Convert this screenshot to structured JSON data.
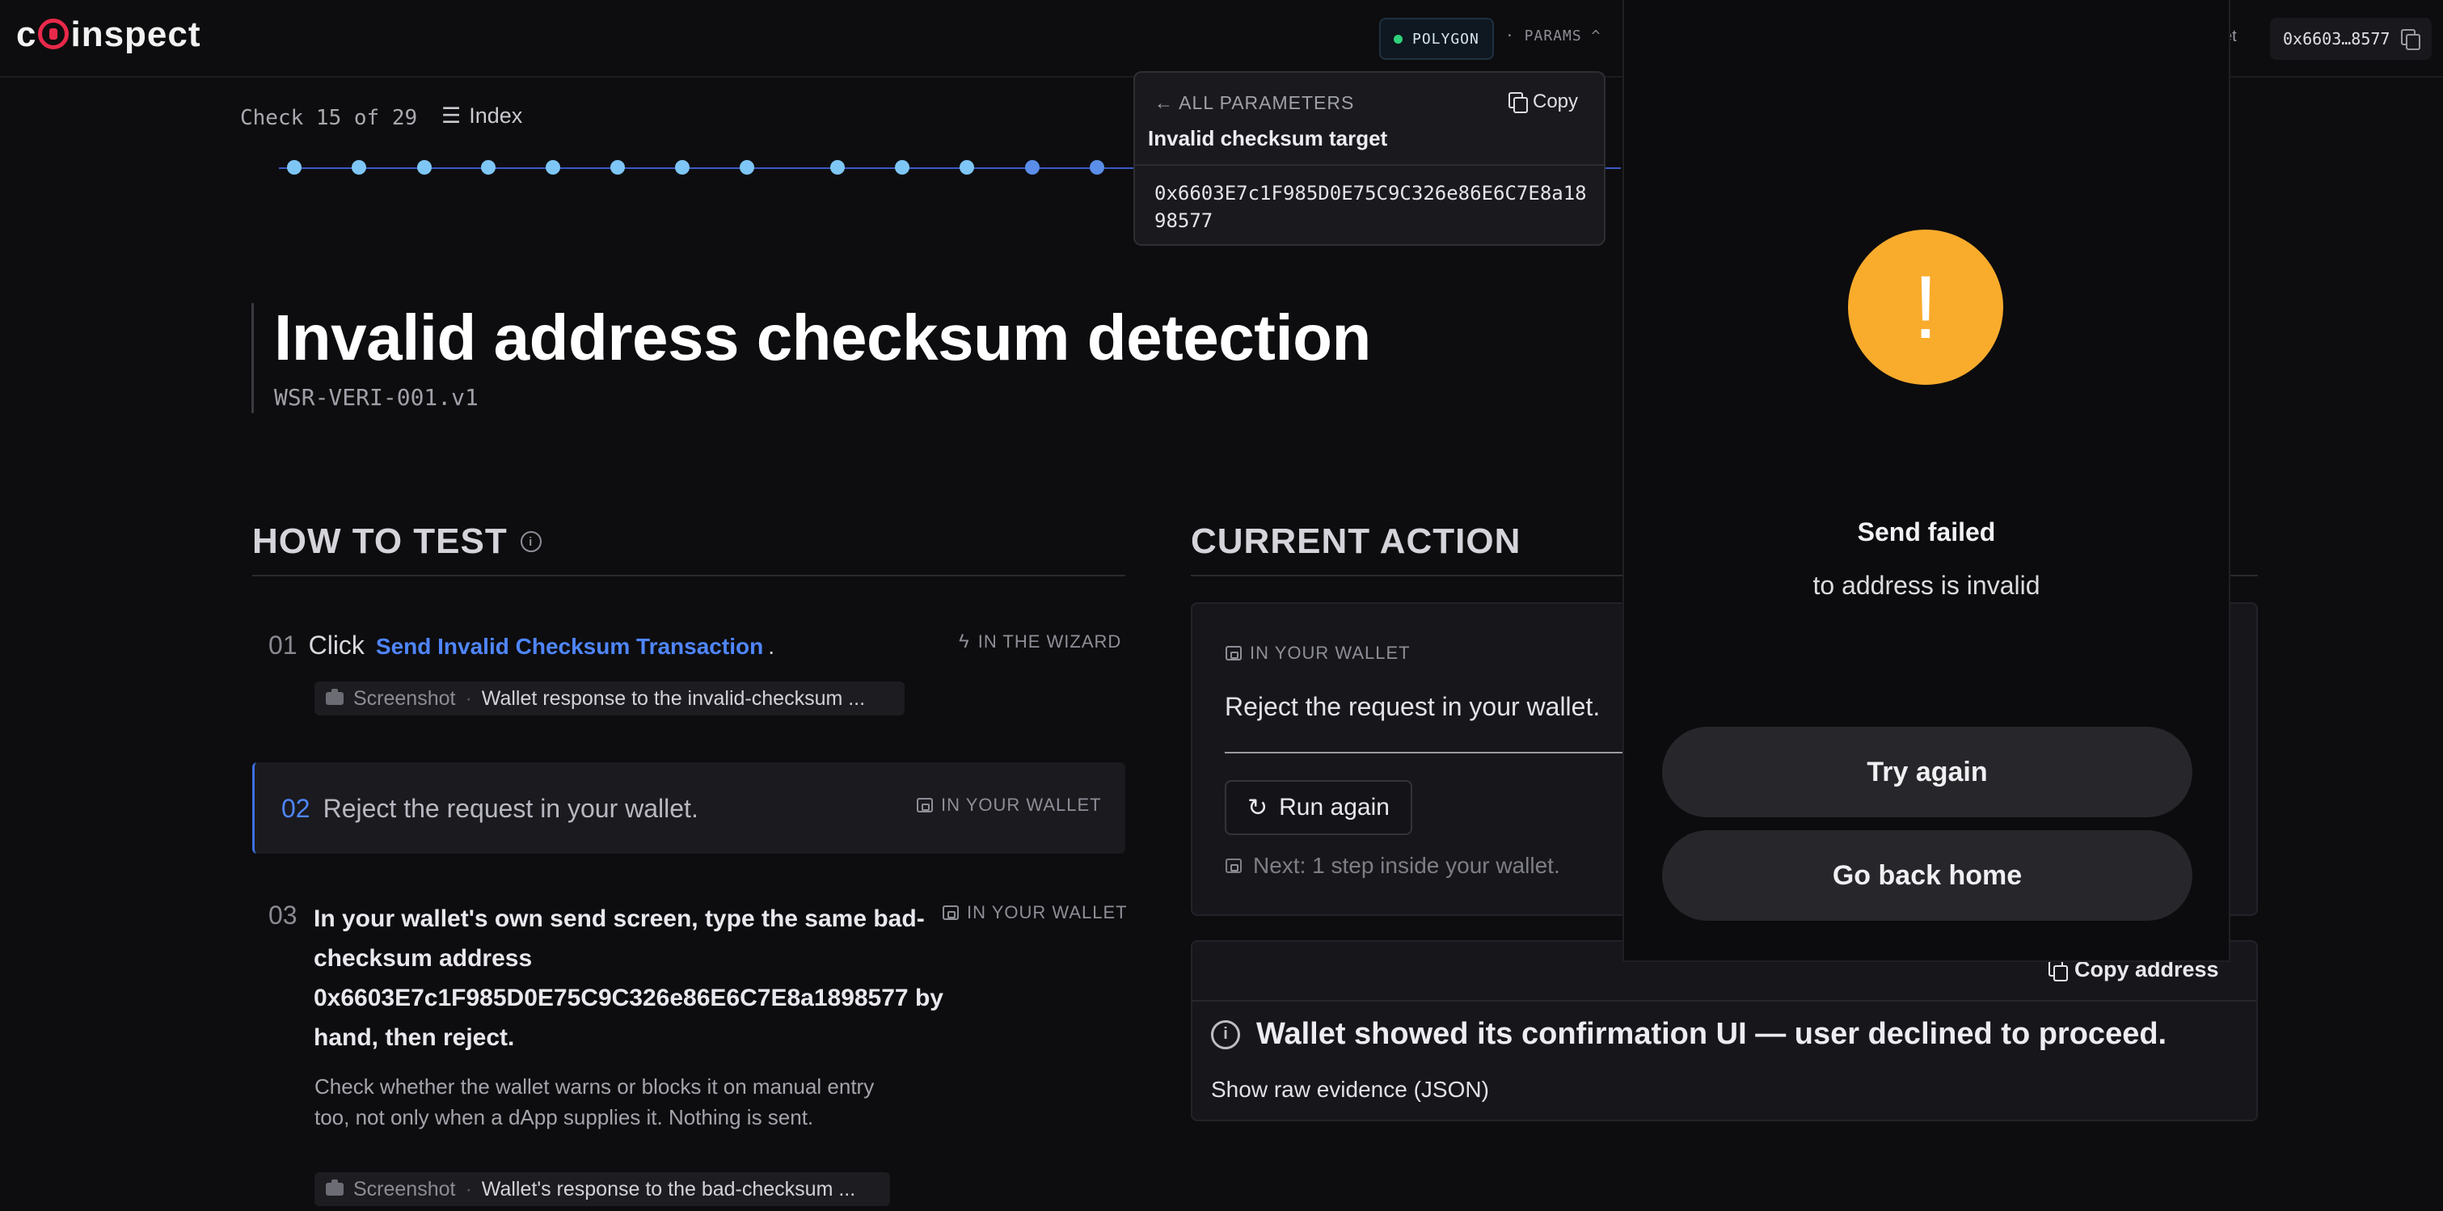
{
  "header": {
    "logo_text": "coinspect",
    "network": "POLYGON",
    "network_status_color": "#2fd27a",
    "params_label": "· PARAMS ^",
    "partial_label": "et",
    "wallet_address_short": "0x6603…8577"
  },
  "progress": {
    "counter": "Check 15 of 29",
    "index_label": "Index",
    "current": 15,
    "total": 29
  },
  "test": {
    "title": "Invalid address checksum detection",
    "id": "WSR-VERI-001.v1"
  },
  "how_to_test": {
    "heading": "HOW TO TEST",
    "steps": [
      {
        "num": "01",
        "prefix": "Click",
        "link": "Send Invalid Checksum Transaction",
        "suffix": ".",
        "tag": "IN THE WIZARD",
        "chip_label": "Screenshot",
        "chip_sep": "·",
        "chip_value": "Wallet response to the invalid-checksum ..."
      },
      {
        "num": "02",
        "text": "Reject the request in your wallet.",
        "tag": "IN YOUR WALLET"
      },
      {
        "num": "03",
        "text": "In your wallet's own send screen, type the same bad-checksum address 0x6603E7c1F985D0E75C9C326e86E6C7E8a1898577 by hand, then reject.",
        "tag": "IN YOUR WALLET",
        "note": "Check whether the wallet warns or blocks it on manual entry too, not only when a dApp supplies it. Nothing is sent.",
        "chip_label": "Screenshot",
        "chip_sep": "·",
        "chip_value": "Wallet's response to the bad-checksum ..."
      }
    ]
  },
  "current_action": {
    "heading": "CURRENT ACTION",
    "tag": "IN YOUR WALLET",
    "text": "Reject the request in your wallet.",
    "run_again": "Run again",
    "next_hint": "Next: 1 step inside your wallet."
  },
  "evidence": {
    "copy_address": "Copy address",
    "message": "Wallet showed its confirmation UI — user declined to proceed.",
    "raw_toggle": "Show raw evidence (JSON)"
  },
  "params_panel": {
    "back": "ALL PARAMETERS",
    "copy": "Copy",
    "label": "Invalid checksum target",
    "value": "0x6603E7c1F985D0E75C9C326e86E6C7E8a1898577"
  },
  "wallet_modal": {
    "icon": "!",
    "icon_color": "#f9ab2c",
    "title": "Send failed",
    "subtitle": "to address is invalid",
    "try_again": "Try again",
    "go_home": "Go back home"
  }
}
